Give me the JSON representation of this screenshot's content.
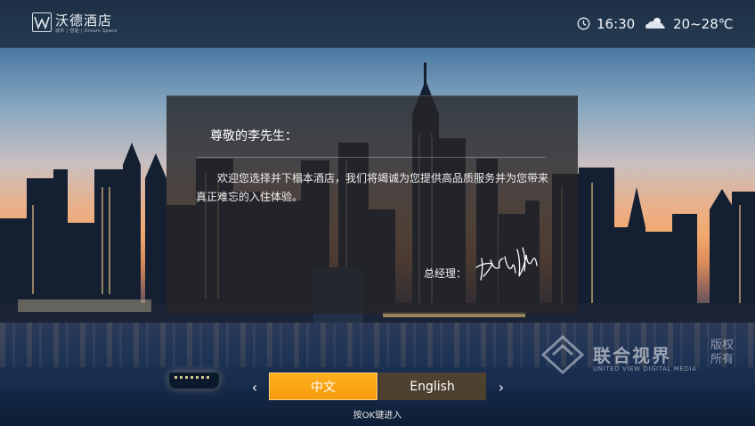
{
  "header": {
    "brand_name": "沃德酒店",
    "brand_tagline": "城市 | 智能 | Dream Space",
    "time": "16:30",
    "temperature": "20~28℃",
    "icons": {
      "clock": "clock-icon",
      "weather": "cloudy-icon",
      "logo": "logo-icon"
    }
  },
  "welcome": {
    "greeting": "尊敬的李先生：",
    "message": "欢迎您选择并下榻本酒店，我们将竭诚为您提供高品质服务并为您带来真正难忘的入住体验。",
    "manager_label": "总经理：",
    "signature_icon": "signature-image"
  },
  "language": {
    "options": [
      "中文",
      "English"
    ],
    "selected": "中文",
    "hint": "按OK键进入",
    "colors": {
      "selected_bg": "#f7a313",
      "unselected_bg": "#5a4628"
    }
  },
  "watermark": {
    "cn": "联合视界",
    "en": "UNITED VIEW DIGITAL MEDIA",
    "rights": "版权所有"
  }
}
